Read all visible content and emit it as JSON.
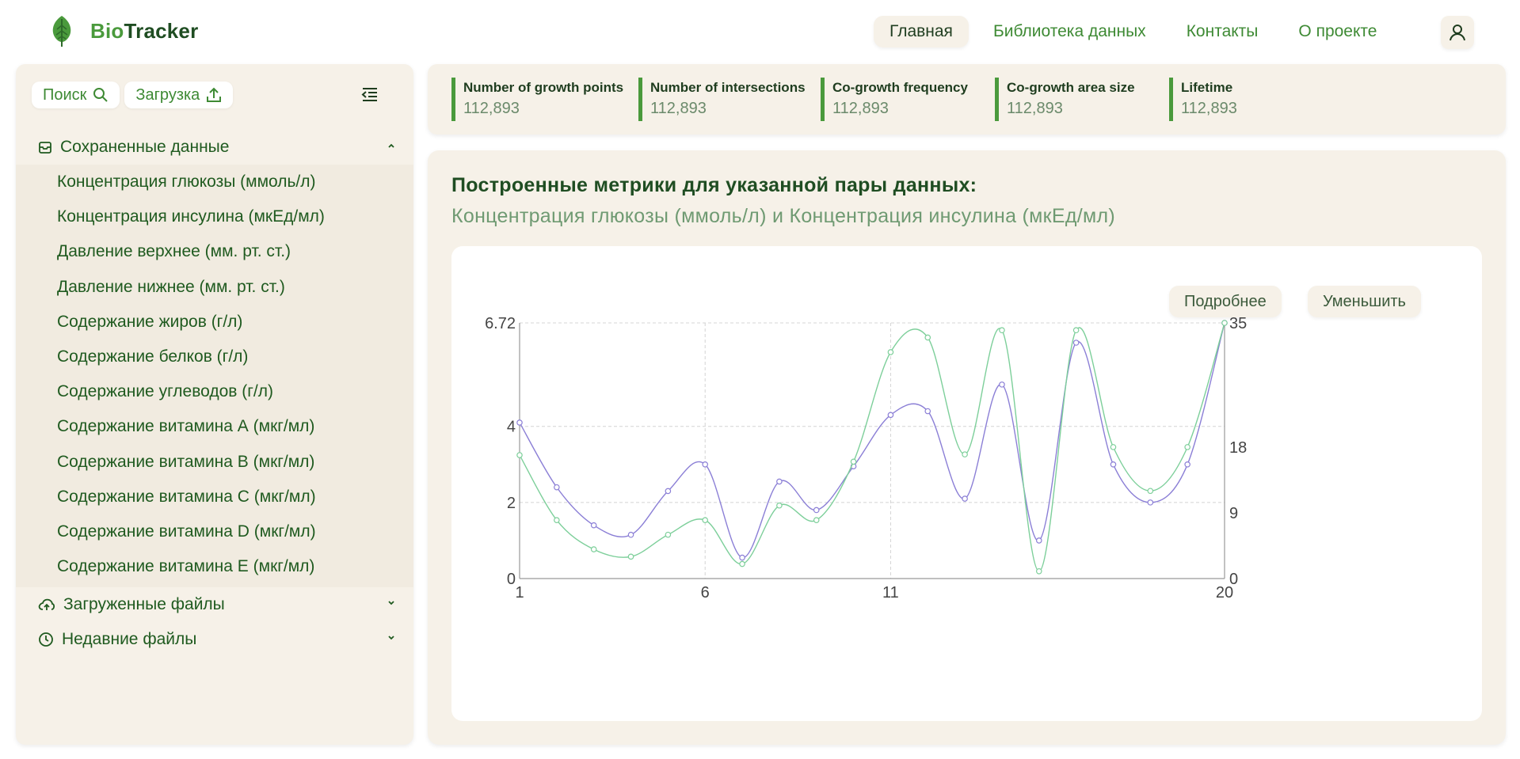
{
  "app": {
    "name_part1": "Bio",
    "name_part2": "Tracker"
  },
  "nav": {
    "items": [
      {
        "label": "Главная",
        "active": true
      },
      {
        "label": "Библиотека данных",
        "active": false
      },
      {
        "label": "Контакты",
        "active": false
      },
      {
        "label": "О проекте",
        "active": false
      }
    ]
  },
  "sidebar": {
    "search_label": "Поиск",
    "upload_label": "Загрузка",
    "saved_section": "Сохраненные данные",
    "saved_items": [
      "Концентрация глюкозы (ммоль/л)",
      "Концентрация инсулина (мкЕд/мл)",
      "Давление верхнее (мм. рт. ст.)",
      "Давление нижнее (мм. рт. ст.)",
      "Содержание жиров (г/л)",
      "Содержание белков (г/л)",
      "Содержание углеводов (г/л)",
      "Содержание витамина А (мкг/мл)",
      "Содержание витамина В (мкг/мл)",
      "Содержание витамина С (мкг/мл)",
      "Содержание витамина D (мкг/мл)",
      "Содержание витамина Е (мкг/мл)"
    ],
    "uploaded_section": "Загруженные файлы",
    "recent_section": "Недавние файлы"
  },
  "stats": [
    {
      "title": "Number of growth points",
      "value": "112,893"
    },
    {
      "title": "Number of intersections",
      "value": "112,893"
    },
    {
      "title": "Co-growth frequency",
      "value": "112,893"
    },
    {
      "title": "Co-growth area size",
      "value": "112,893"
    },
    {
      "title": "Lifetime",
      "value": "112,893"
    }
  ],
  "main": {
    "title": "Построенные метрики для указанной пары данных:",
    "subtitle": "Концентрация глюкозы (ммоль/л) и Концентрация инсулина (мкЕд/мл)",
    "details_label": "Подробнее",
    "shrink_label": "Уменьшить"
  },
  "colors": {
    "accent": "#4a9a3c",
    "series_purple": "#8b7fd6",
    "series_green": "#7dcf9a"
  },
  "chart_data": {
    "type": "line",
    "x": [
      1,
      2,
      3,
      4,
      5,
      6,
      7,
      8,
      9,
      10,
      11,
      12,
      13,
      14,
      15,
      16,
      17,
      18,
      19,
      20
    ],
    "xticks": [
      "1",
      "6",
      "11",
      "20"
    ],
    "yticks_left": [
      "0",
      "2",
      "4",
      "6.72"
    ],
    "yticks_right": [
      "0",
      "9",
      "18",
      "35"
    ],
    "ylim_left": [
      0,
      6.72
    ],
    "ylim_right": [
      0,
      35
    ],
    "grid": true,
    "series": [
      {
        "axis": "left",
        "values": [
          4.1,
          2.4,
          1.4,
          1.15,
          2.3,
          3.0,
          0.55,
          2.55,
          1.8,
          2.95,
          4.3,
          4.4,
          2.1,
          5.1,
          1.0,
          6.2,
          3.0,
          2.0,
          3.0,
          6.72
        ]
      },
      {
        "axis": "right",
        "values": [
          16.9,
          8.0,
          4.0,
          3.0,
          6.0,
          8.0,
          2.0,
          10.0,
          8.0,
          16.0,
          31.0,
          33.0,
          17.0,
          34.0,
          1.0,
          34.0,
          18.0,
          12.0,
          18.0,
          35.0
        ]
      }
    ]
  }
}
